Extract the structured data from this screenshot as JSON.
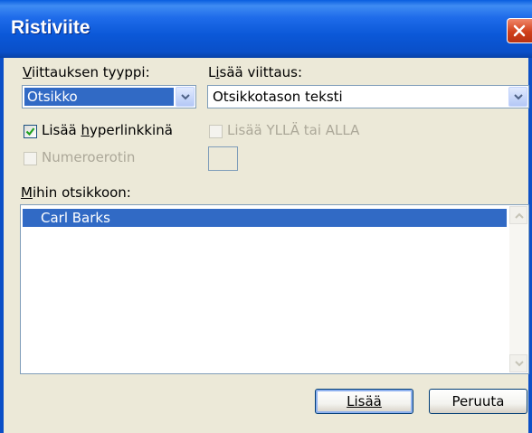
{
  "dialog": {
    "title": "Ristiviite",
    "close_icon": "close-icon"
  },
  "reference_type": {
    "label": "Viittauksen tyyppi:",
    "value": "Otsikko"
  },
  "insert_reference": {
    "label": "Lisää viittaus:",
    "value": "Otsikkotason teksti"
  },
  "options": {
    "hyperlink": {
      "label_pre": "Lisää ",
      "label_u": "h",
      "label_post": "yperlinkkinä",
      "checked": true
    },
    "separator": {
      "label": "Numeroerotin",
      "checked": false,
      "enabled": false
    },
    "above_below": {
      "label": "Lisää YLLÄ tai ALLA",
      "checked": false,
      "enabled": false
    }
  },
  "which_heading": {
    "label": "Mihin otsikkoon:",
    "items": [
      "Carl Barks"
    ]
  },
  "buttons": {
    "insert": "Lisää",
    "cancel": "Peruuta"
  },
  "colors": {
    "titlebar": "#0b58d8",
    "selection": "#316ac5",
    "dialog_bg": "#ece9d8"
  }
}
